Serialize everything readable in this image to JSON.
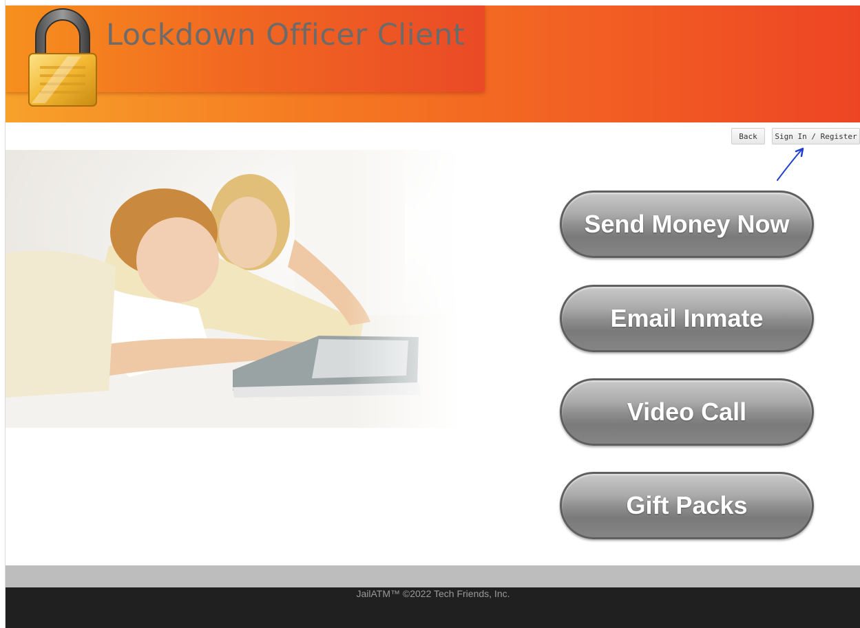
{
  "header": {
    "title": "Lockdown Officer Client",
    "logo_icon": "padlock-icon",
    "gradient_start": "#f7a12a",
    "gradient_end": "#ed4524"
  },
  "topbar": {
    "back_label": "Back",
    "signin_label": "Sign In / Register"
  },
  "hero": {
    "image": "photo-mother-and-child-using-laptop"
  },
  "actions": [
    {
      "label": "Send Money Now"
    },
    {
      "label": "Email Inmate"
    },
    {
      "label": "Video Call"
    },
    {
      "label": "Gift Packs"
    }
  ],
  "footer": {
    "text": "JailATM™ ©2022 Tech Friends, Inc."
  },
  "annotation": {
    "color": "#1f3fd1",
    "icon": "hand-drawn-arrow"
  }
}
